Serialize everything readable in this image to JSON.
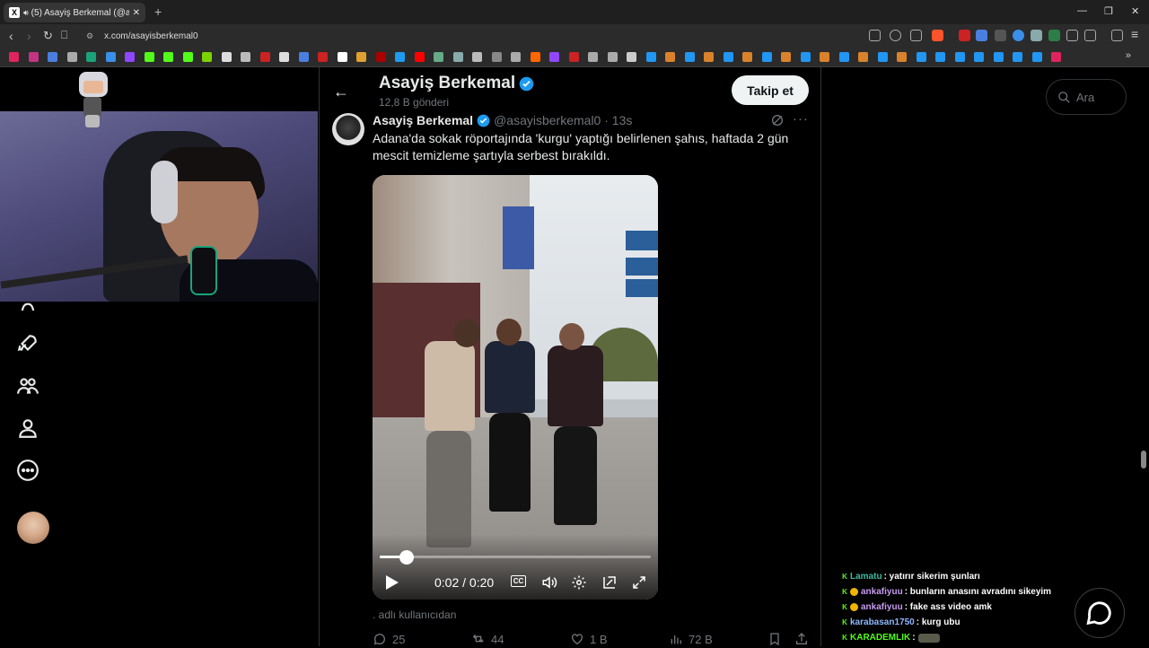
{
  "browser": {
    "tab_title": "(5) Asayiş Berkemal (@asayis",
    "tab_icon": "x-logo-icon",
    "url": "x.com/asayisberkemal0"
  },
  "profile": {
    "name": "Asayiş Berkemal",
    "post_count": "12,8 B gönderi",
    "follow_label": "Takip et"
  },
  "search": {
    "placeholder": "Ara"
  },
  "tweet": {
    "author": "Asayiş Berkemal",
    "handle": "@asayisberkemal0 · 13s",
    "text": "Adana'da sokak röportajında 'kurgu' yaptığı belirlenen şahıs, haftada 2 gün mescit temizleme şartıyla serbest bırakıldı.",
    "source_note": ". adlı kullanıcıdan",
    "video": {
      "time": "0:02 / 0:20",
      "cc_label": "CC",
      "progress": 0.1
    },
    "actions": {
      "replies": "25",
      "retweets": "44",
      "likes": "1 B",
      "views": "72 B"
    }
  },
  "chat": [
    {
      "user": "Lamatu",
      "user_color": "#3fb8a0",
      "message": ": yatırır sikerim şunları",
      "badges": [
        "kick"
      ]
    },
    {
      "user": "ankafiyuu",
      "user_color": "#c79bf2",
      "message": ": bunların anasını avradını sikeyim",
      "badges": [
        "kick",
        "coin"
      ]
    },
    {
      "user": "ankafiyuu",
      "user_color": "#c79bf2",
      "message": ": fake ass video amk",
      "badges": [
        "kick",
        "coin"
      ]
    },
    {
      "user": "karabasan1750",
      "user_color": "#8fb8ff",
      "message": ": kurg ubu",
      "badges": [
        "kick"
      ]
    },
    {
      "user": "KARADEMLIK",
      "user_color": "#53fc18",
      "message": ":",
      "badges": [
        "kick"
      ],
      "emote": true
    }
  ],
  "colors": {
    "accent": "#1d9bf0",
    "kick_green": "#53fc18",
    "background": "#000000"
  }
}
